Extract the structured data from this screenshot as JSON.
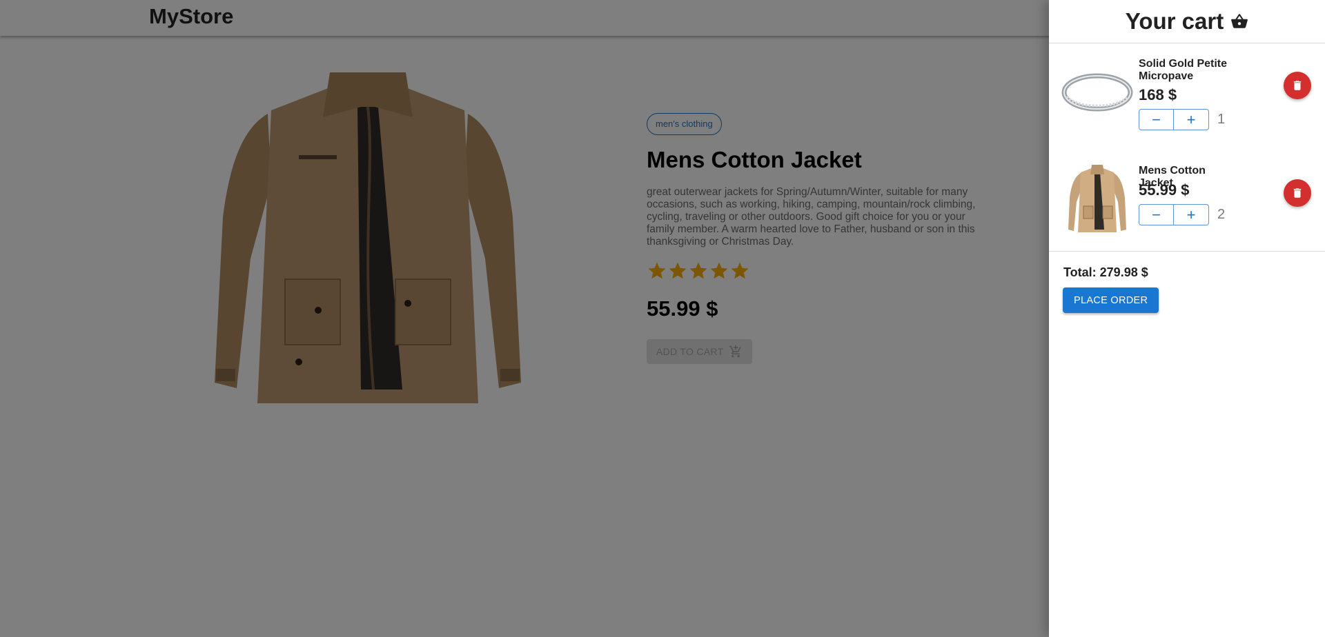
{
  "header": {
    "brand": "MyStore"
  },
  "product": {
    "category": "men's clothing",
    "title": "Mens Cotton Jacket",
    "description": "great outerwear jackets for Spring/Autumn/Winter, suitable for many occasions, such as working, hiking, camping, mountain/rock climbing, cycling, traveling or other outdoors. Good gift choice for you or your family member. A warm hearted love to Father, husband or son in this thanksgiving or Christmas Day.",
    "rating_stars": 5,
    "price": "55.99 $",
    "add_to_cart_label": "ADD TO CART",
    "add_to_cart_icon": "cart-add-icon",
    "image_icon": "jacket-image"
  },
  "cart": {
    "title": "Your cart",
    "title_icon": "basket-icon",
    "items": [
      {
        "name": "Solid Gold Petite Micropave",
        "price": "168 $",
        "quantity": "1",
        "image_icon": "ring-image",
        "minus_label": "−",
        "plus_label": "+"
      },
      {
        "name": "Mens Cotton Jacket",
        "price": "55.99 $",
        "quantity": "2",
        "image_icon": "jacket-image",
        "minus_label": "−",
        "plus_label": "+"
      }
    ],
    "total": "Total: 279.98 $",
    "place_order_label": "PLACE ORDER"
  },
  "colors": {
    "primary": "#1976d2",
    "danger": "#d32f2f",
    "star": "#faaf00",
    "backdrop": "rgba(0,0,0,0.5)"
  }
}
